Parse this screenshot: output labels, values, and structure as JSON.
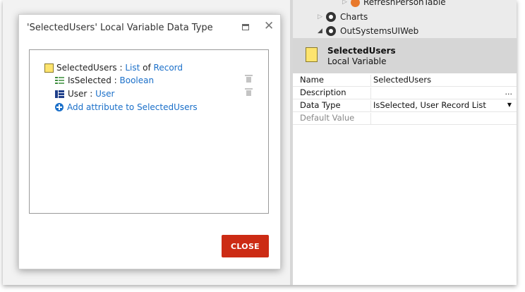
{
  "tree": {
    "items": [
      {
        "label": "RefreshPersonTable",
        "icon": "action-icon"
      },
      {
        "label": "Charts",
        "icon": "module-icon"
      },
      {
        "label": "OutSystemsUIWeb",
        "icon": "module-icon"
      }
    ]
  },
  "properties_header": {
    "name": "SelectedUsers",
    "type": "Local Variable"
  },
  "properties": [
    {
      "key": "Name",
      "value": "SelectedUsers",
      "control": ""
    },
    {
      "key": "Description",
      "value": "",
      "control": "..."
    },
    {
      "key": "Data Type",
      "value": "IsSelected, User Record List",
      "control": "▼"
    },
    {
      "key": "Default Value",
      "value": "",
      "control": ""
    }
  ],
  "dialog": {
    "title": "'SelectedUsers' Local Variable Data Type",
    "structure": {
      "name": "SelectedUsers",
      "sep": ":",
      "list_label": "List",
      "of_label": "of",
      "record_label": "Record"
    },
    "attributes": [
      {
        "name": "IsSelected",
        "sep": ":",
        "type": "Boolean",
        "icon": "attribute-icon"
      },
      {
        "name": "User",
        "sep": ":",
        "type": "User",
        "icon": "entity-icon"
      }
    ],
    "add_attribute_label": "Add attribute to SelectedUsers",
    "close_label": "CLOSE"
  },
  "colors": {
    "accent_link": "#1a6fc9",
    "close_button": "#cc2b14",
    "variable_icon": "#fde46e"
  }
}
